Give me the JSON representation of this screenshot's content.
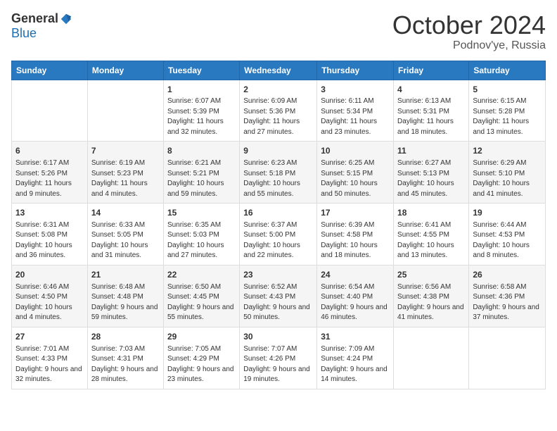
{
  "logo": {
    "general": "General",
    "blue": "Blue"
  },
  "header": {
    "month": "October 2024",
    "location": "Podnov'ye, Russia"
  },
  "weekdays": [
    "Sunday",
    "Monday",
    "Tuesday",
    "Wednesday",
    "Thursday",
    "Friday",
    "Saturday"
  ],
  "weeks": [
    [
      {
        "day": "",
        "info": ""
      },
      {
        "day": "",
        "info": ""
      },
      {
        "day": "1",
        "info": "Sunrise: 6:07 AM\nSunset: 5:39 PM\nDaylight: 11 hours and 32 minutes."
      },
      {
        "day": "2",
        "info": "Sunrise: 6:09 AM\nSunset: 5:36 PM\nDaylight: 11 hours and 27 minutes."
      },
      {
        "day": "3",
        "info": "Sunrise: 6:11 AM\nSunset: 5:34 PM\nDaylight: 11 hours and 23 minutes."
      },
      {
        "day": "4",
        "info": "Sunrise: 6:13 AM\nSunset: 5:31 PM\nDaylight: 11 hours and 18 minutes."
      },
      {
        "day": "5",
        "info": "Sunrise: 6:15 AM\nSunset: 5:28 PM\nDaylight: 11 hours and 13 minutes."
      }
    ],
    [
      {
        "day": "6",
        "info": "Sunrise: 6:17 AM\nSunset: 5:26 PM\nDaylight: 11 hours and 9 minutes."
      },
      {
        "day": "7",
        "info": "Sunrise: 6:19 AM\nSunset: 5:23 PM\nDaylight: 11 hours and 4 minutes."
      },
      {
        "day": "8",
        "info": "Sunrise: 6:21 AM\nSunset: 5:21 PM\nDaylight: 10 hours and 59 minutes."
      },
      {
        "day": "9",
        "info": "Sunrise: 6:23 AM\nSunset: 5:18 PM\nDaylight: 10 hours and 55 minutes."
      },
      {
        "day": "10",
        "info": "Sunrise: 6:25 AM\nSunset: 5:15 PM\nDaylight: 10 hours and 50 minutes."
      },
      {
        "day": "11",
        "info": "Sunrise: 6:27 AM\nSunset: 5:13 PM\nDaylight: 10 hours and 45 minutes."
      },
      {
        "day": "12",
        "info": "Sunrise: 6:29 AM\nSunset: 5:10 PM\nDaylight: 10 hours and 41 minutes."
      }
    ],
    [
      {
        "day": "13",
        "info": "Sunrise: 6:31 AM\nSunset: 5:08 PM\nDaylight: 10 hours and 36 minutes."
      },
      {
        "day": "14",
        "info": "Sunrise: 6:33 AM\nSunset: 5:05 PM\nDaylight: 10 hours and 31 minutes."
      },
      {
        "day": "15",
        "info": "Sunrise: 6:35 AM\nSunset: 5:03 PM\nDaylight: 10 hours and 27 minutes."
      },
      {
        "day": "16",
        "info": "Sunrise: 6:37 AM\nSunset: 5:00 PM\nDaylight: 10 hours and 22 minutes."
      },
      {
        "day": "17",
        "info": "Sunrise: 6:39 AM\nSunset: 4:58 PM\nDaylight: 10 hours and 18 minutes."
      },
      {
        "day": "18",
        "info": "Sunrise: 6:41 AM\nSunset: 4:55 PM\nDaylight: 10 hours and 13 minutes."
      },
      {
        "day": "19",
        "info": "Sunrise: 6:44 AM\nSunset: 4:53 PM\nDaylight: 10 hours and 8 minutes."
      }
    ],
    [
      {
        "day": "20",
        "info": "Sunrise: 6:46 AM\nSunset: 4:50 PM\nDaylight: 10 hours and 4 minutes."
      },
      {
        "day": "21",
        "info": "Sunrise: 6:48 AM\nSunset: 4:48 PM\nDaylight: 9 hours and 59 minutes."
      },
      {
        "day": "22",
        "info": "Sunrise: 6:50 AM\nSunset: 4:45 PM\nDaylight: 9 hours and 55 minutes."
      },
      {
        "day": "23",
        "info": "Sunrise: 6:52 AM\nSunset: 4:43 PM\nDaylight: 9 hours and 50 minutes."
      },
      {
        "day": "24",
        "info": "Sunrise: 6:54 AM\nSunset: 4:40 PM\nDaylight: 9 hours and 46 minutes."
      },
      {
        "day": "25",
        "info": "Sunrise: 6:56 AM\nSunset: 4:38 PM\nDaylight: 9 hours and 41 minutes."
      },
      {
        "day": "26",
        "info": "Sunrise: 6:58 AM\nSunset: 4:36 PM\nDaylight: 9 hours and 37 minutes."
      }
    ],
    [
      {
        "day": "27",
        "info": "Sunrise: 7:01 AM\nSunset: 4:33 PM\nDaylight: 9 hours and 32 minutes."
      },
      {
        "day": "28",
        "info": "Sunrise: 7:03 AM\nSunset: 4:31 PM\nDaylight: 9 hours and 28 minutes."
      },
      {
        "day": "29",
        "info": "Sunrise: 7:05 AM\nSunset: 4:29 PM\nDaylight: 9 hours and 23 minutes."
      },
      {
        "day": "30",
        "info": "Sunrise: 7:07 AM\nSunset: 4:26 PM\nDaylight: 9 hours and 19 minutes."
      },
      {
        "day": "31",
        "info": "Sunrise: 7:09 AM\nSunset: 4:24 PM\nDaylight: 9 hours and 14 minutes."
      },
      {
        "day": "",
        "info": ""
      },
      {
        "day": "",
        "info": ""
      }
    ]
  ]
}
